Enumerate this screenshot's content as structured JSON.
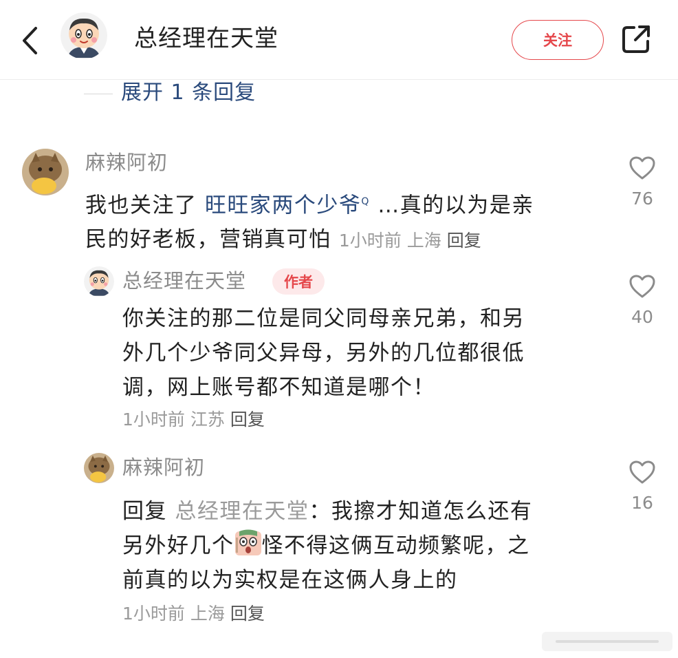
{
  "header": {
    "title": "总经理在天堂",
    "follow_label": "关注"
  },
  "expand_replies": "展开 1 条回复",
  "comments": [
    {
      "username": "麻辣阿初",
      "text_before_link": "我也关注了 ",
      "link_text": "旺旺家两个少爷",
      "link_mark": "Q",
      "text_after_link_line1": " …真的以为是亲",
      "text_line2": "民的好老板，营销真可怕",
      "time": "1小时前",
      "location": "上海",
      "reply_label": "回复",
      "like_count": "76"
    },
    {
      "username": "总经理在天堂",
      "badge": "作者",
      "text_line1": "你关注的那二位是同父同母亲兄弟，和另",
      "text_line2": "外几个少爷同父异母，另外的几位都很低",
      "text_line3": "调，网上账号都不知道是哪个！",
      "time": "1小时前",
      "location": "江苏",
      "reply_label": "回复",
      "like_count": "40"
    },
    {
      "username": "麻辣阿初",
      "reply_prefix": "回复 ",
      "mention": "总经理在天堂",
      "text_line1": "：我擦才知道怎么还有",
      "text_line2a": "另外好几个",
      "text_line2b": "怪不得这俩互动频繁呢，之",
      "text_line3": "前真的以为实权是在这俩人身上的",
      "time": "1小时前",
      "location": "上海",
      "reply_label": "回复",
      "like_count": "16"
    }
  ],
  "icons": {
    "back": "chevron-left-icon",
    "share": "share-external-icon",
    "like": "heart-outline-icon"
  },
  "colors": {
    "accent_red": "#e5474b",
    "link_blue": "#2a4a7c",
    "meta_gray": "#9a9a9a"
  }
}
